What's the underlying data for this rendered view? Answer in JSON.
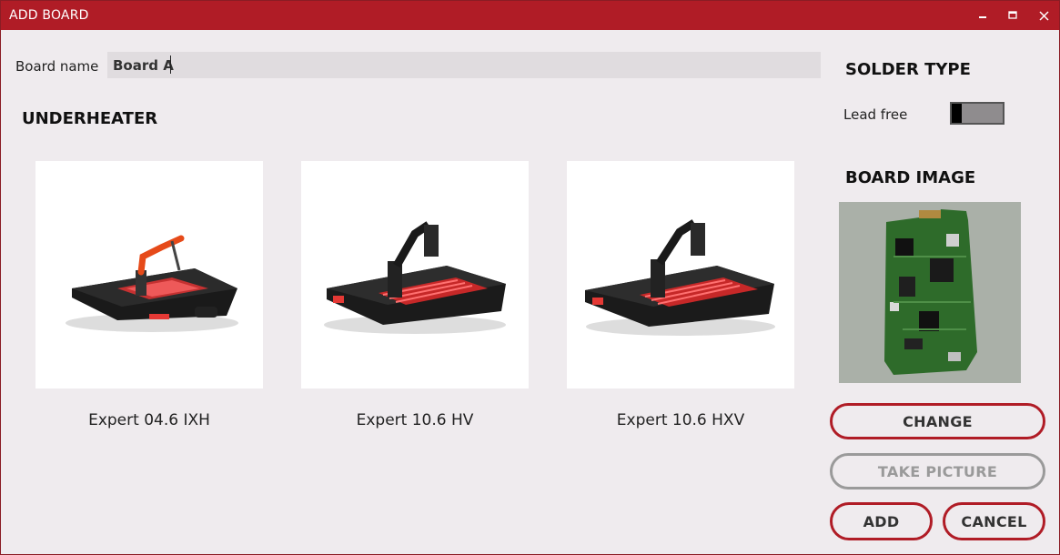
{
  "window": {
    "title": "ADD BOARD",
    "controls": {
      "minimize": "🗕",
      "maximize": "🗖",
      "close": "✕"
    },
    "accent_color": "#b01c26"
  },
  "form": {
    "board_name_label": "Board name",
    "board_name_value": "Board A"
  },
  "underheater": {
    "title": "UNDERHEATER",
    "options": [
      {
        "name": "Expert 04.6 IXH",
        "icon": "rework-station-ixh"
      },
      {
        "name": "Expert 10.6 HV",
        "icon": "rework-station-hv"
      },
      {
        "name": "Expert 10.6 HXV",
        "icon": "rework-station-hxv"
      }
    ]
  },
  "solder": {
    "title": "SOLDER TYPE",
    "lead_free_label": "Lead free",
    "lead_free_on": false
  },
  "board_image": {
    "title": "BOARD IMAGE",
    "icon": "pcb-photo"
  },
  "buttons": {
    "change": "CHANGE",
    "take_picture": "TAKE PICTURE",
    "add": "ADD",
    "cancel": "CANCEL"
  }
}
